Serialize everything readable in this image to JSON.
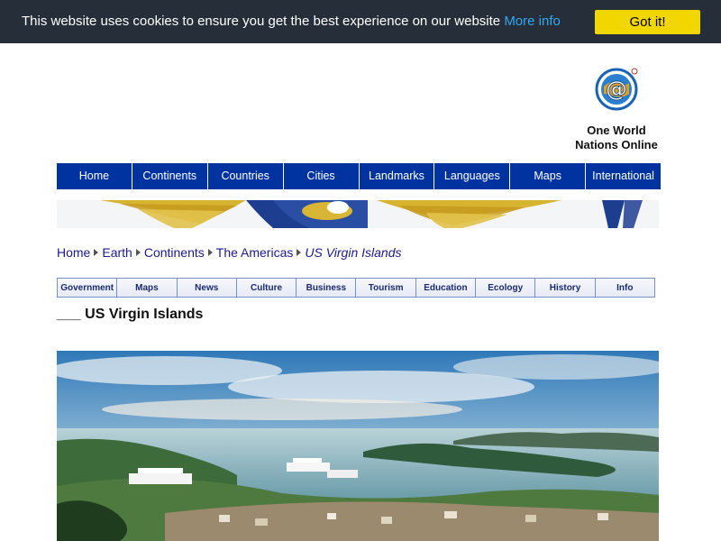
{
  "cookie": {
    "message": "This website uses cookies to ensure you get the best experience on our website",
    "link_label": "More info",
    "button_label": "Got it!"
  },
  "brand": {
    "line1": "One World",
    "line2": "Nations Online"
  },
  "nav": {
    "items": [
      "Home",
      "Continents",
      "Countries",
      "Cities",
      "Landmarks",
      "Languages",
      "Maps",
      "International"
    ]
  },
  "breadcrumb": {
    "items": [
      "Home",
      "Earth",
      "Continents",
      "The Americas"
    ],
    "current": "US Virgin Islands"
  },
  "subnav": {
    "items": [
      "Government",
      "Maps",
      "News",
      "Culture",
      "Business",
      "Tourism",
      "Education",
      "Ecology",
      "History",
      "Info"
    ]
  },
  "page": {
    "heading": "___ US Virgin Islands"
  },
  "colors": {
    "cookie_bg": "#252e39",
    "cookie_button": "#f1d600",
    "cookie_link": "#31a8f0",
    "nav_bg": "#0033a0",
    "link": "#1a1a8c"
  },
  "icons": {
    "logo": "one-world-at-logo-icon",
    "breadcrumb_separator": "triangle-right-icon"
  }
}
